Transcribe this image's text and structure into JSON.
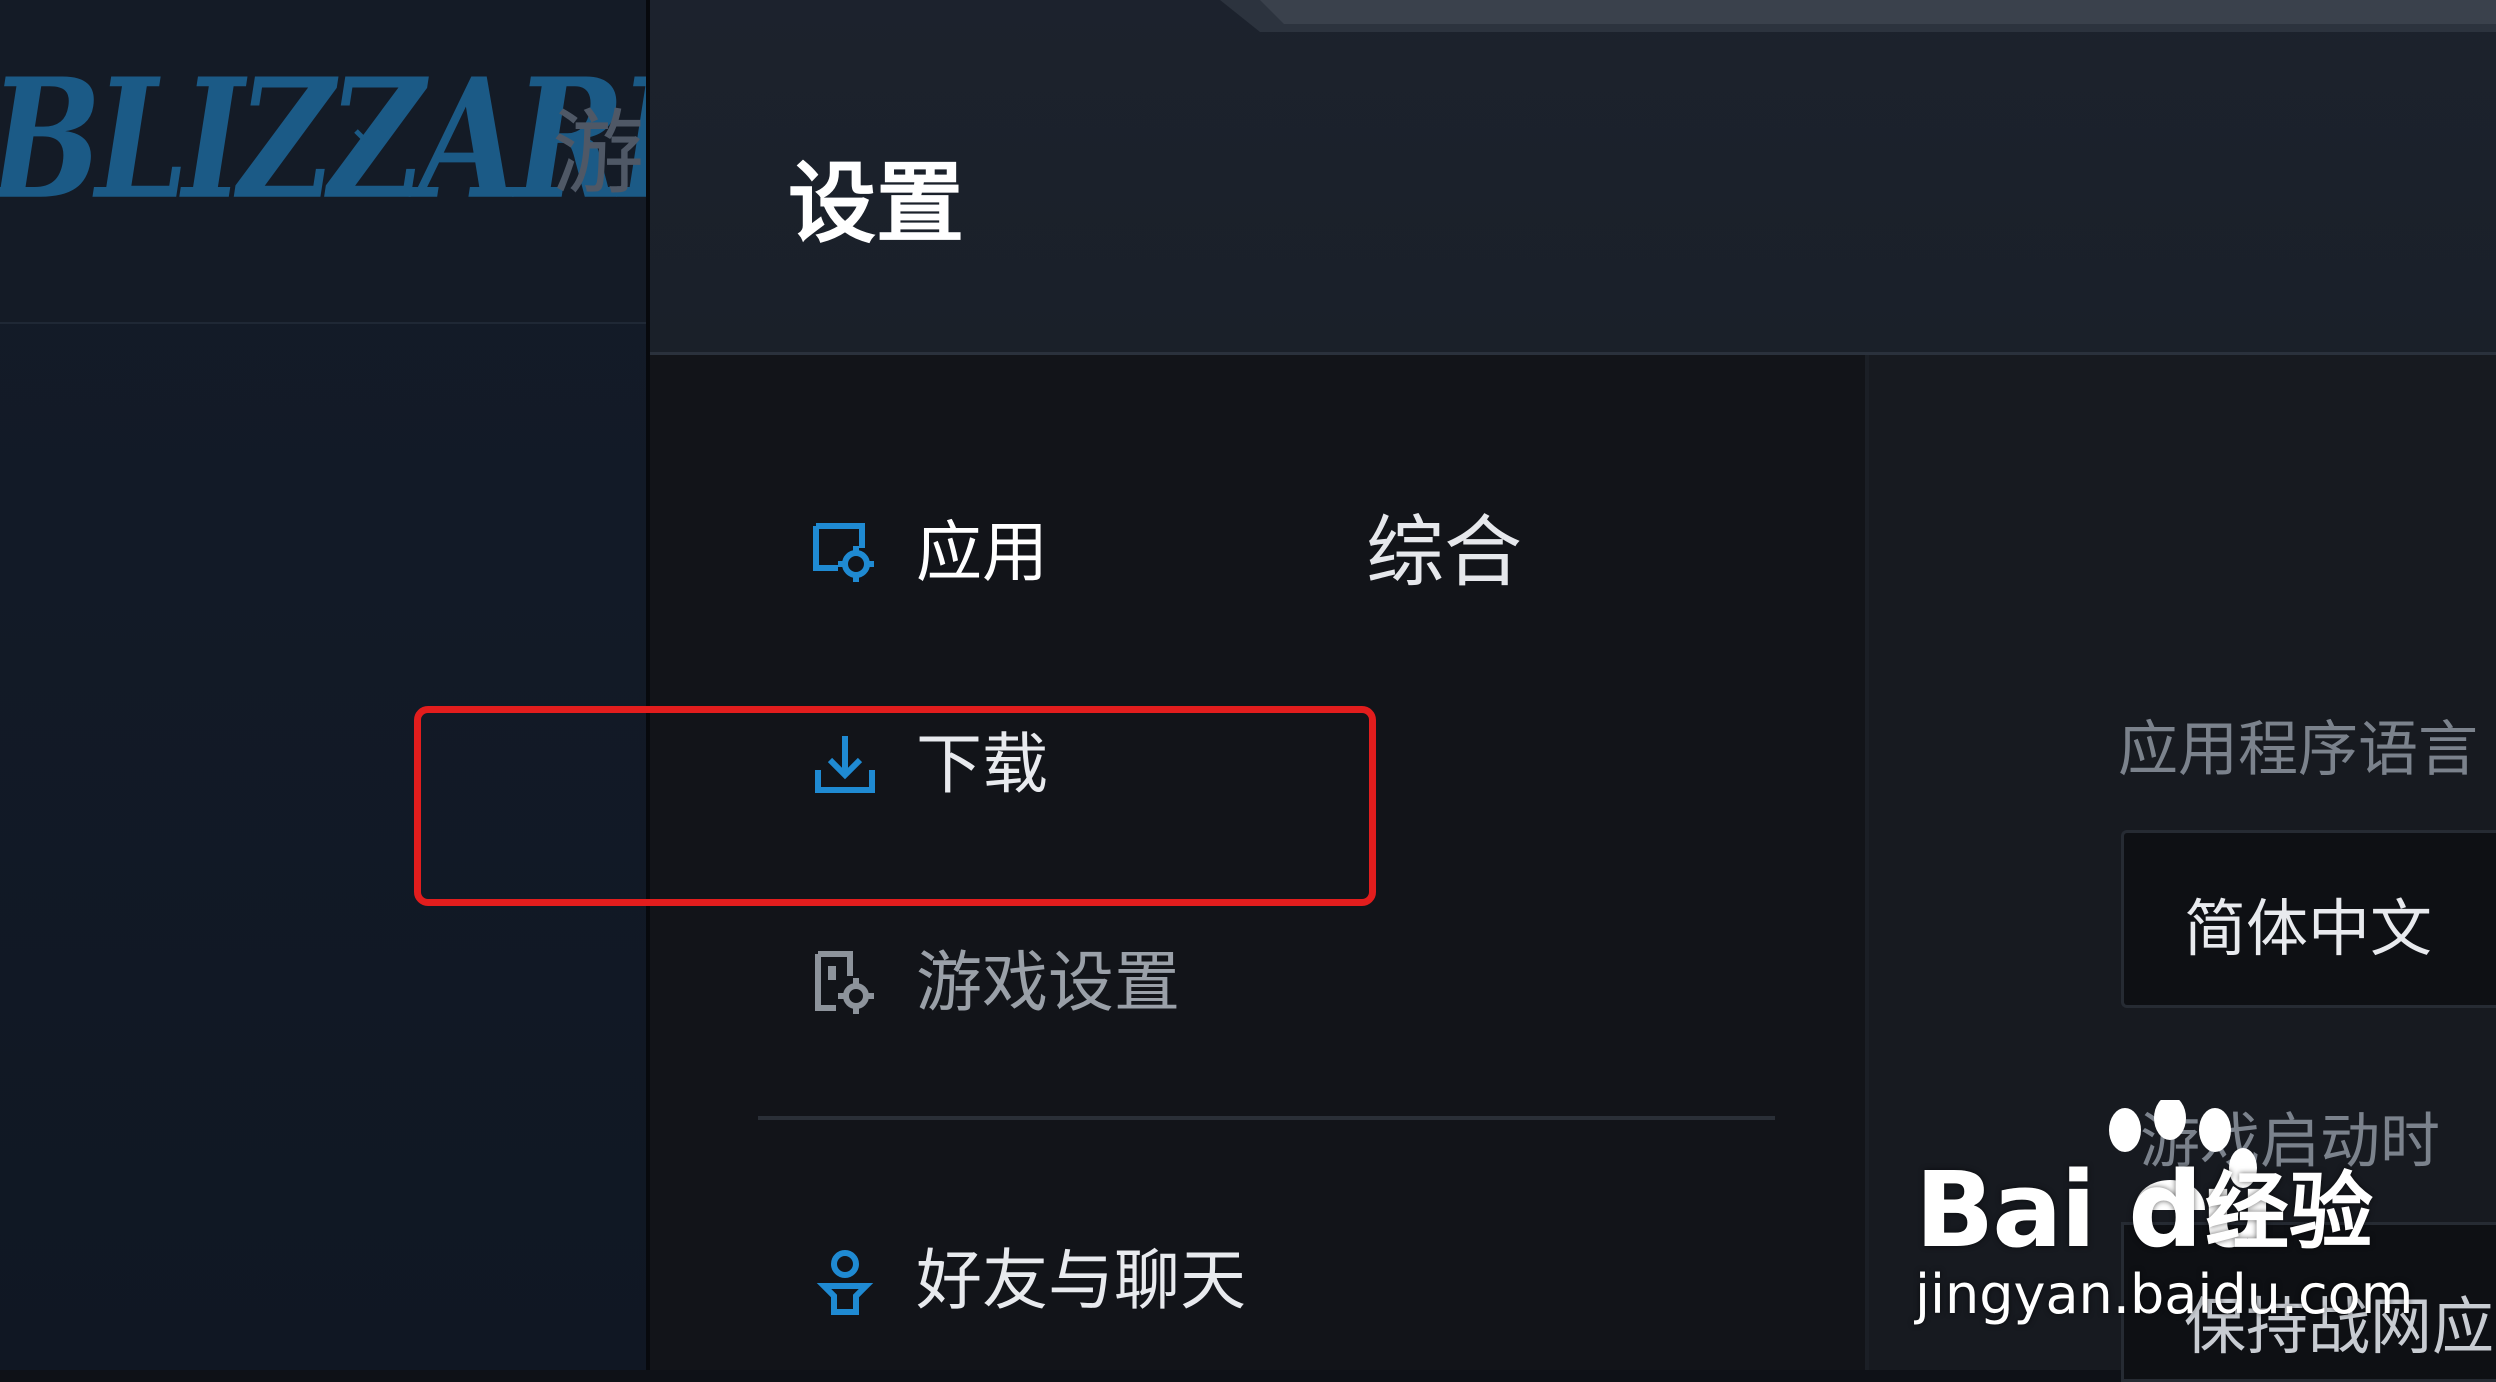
{
  "background_app": {
    "logo_text": "BLIZZARD",
    "nav_partial": "游"
  },
  "settings": {
    "title": "设置",
    "nav": [
      {
        "label": "应用",
        "icon": "monitor-gear-icon",
        "state": "active"
      },
      {
        "label": "下载",
        "icon": "download-icon",
        "state": "normal"
      },
      {
        "label": "游戏设置",
        "icon": "game-gear-icon",
        "state": "dim"
      },
      {
        "label": "好友与聊天",
        "icon": "friend-icon",
        "state": "normal"
      }
    ],
    "section_title": "综合",
    "language_label": "应用程序语言",
    "language_value": "简体中文",
    "launch_label": "游戏启动时",
    "launch_value": "保持战网应"
  },
  "colors": {
    "accent_blue": "#1f8ad2",
    "highlight_red": "#e21d1d",
    "bg_dark": "#111419"
  },
  "watermark": {
    "brand": "Bai du",
    "product": "经验",
    "url": "jingyan.baidu.com"
  }
}
